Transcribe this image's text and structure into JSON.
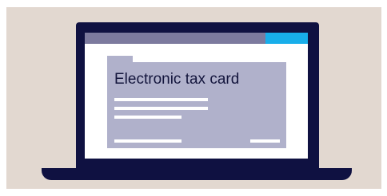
{
  "card": {
    "title": "Electronic tax card"
  },
  "colors": {
    "background": "#e2d8d0",
    "laptop": "#0f1141",
    "browser_bar": "#7c7a9e",
    "accent_button": "#18aeea",
    "card": "#b0b1cb",
    "title_text": "#14163d"
  }
}
